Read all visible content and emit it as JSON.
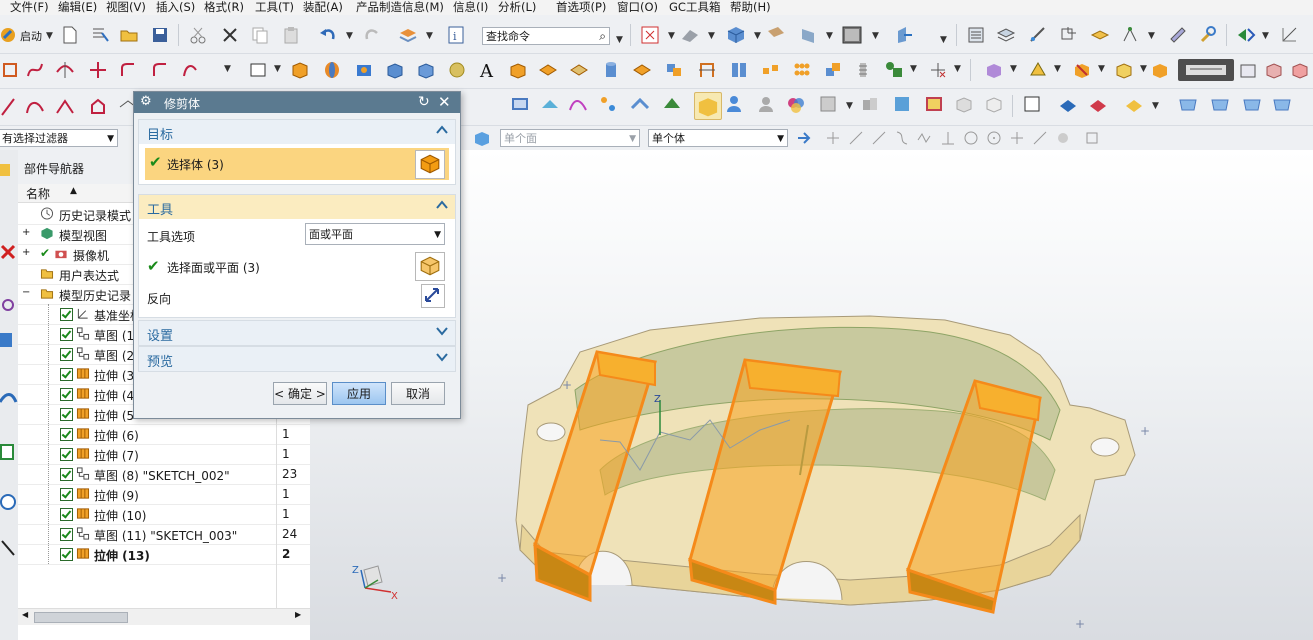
{
  "menubar": [
    "文件(F)",
    "编辑(E)",
    "视图(V)",
    "插入(S)",
    "格式(R)",
    "工具(T)",
    "装配(A)",
    "产品制造信息(M)",
    "信息(I)",
    "分析(L)",
    "首选项(P)",
    "窗口(O)",
    "GC工具箱",
    "帮助(H)"
  ],
  "toolbar": {
    "start_label": "启动",
    "command_search_placeholder": "查找命令"
  },
  "selection_bar": {
    "filter_value": "有选择过滤器",
    "face_rule": "单个面",
    "body_rule": "单个体"
  },
  "navigator": {
    "title": "部件导航器",
    "col_name": "名称",
    "col_sort_glyph": "▲",
    "top_nodes": [
      "历史记录模式",
      "模型视图",
      "摄像机",
      "用户表达式",
      "模型历史记录"
    ],
    "features": [
      {
        "label": "基准坐标",
        "num": "",
        "type": "datum"
      },
      {
        "label": "草图 (1",
        "num": "",
        "type": "sketch"
      },
      {
        "label": "草图 (2",
        "num": "",
        "type": "sketch"
      },
      {
        "label": "拉伸 (3",
        "num": "",
        "type": "extrude"
      },
      {
        "label": "拉伸 (4",
        "num": "",
        "type": "extrude"
      },
      {
        "label": "拉伸 (5",
        "num": "1",
        "type": "extrude"
      },
      {
        "label": "拉伸 (6)",
        "num": "1",
        "type": "extrude"
      },
      {
        "label": "拉伸 (7)",
        "num": "1",
        "type": "extrude"
      },
      {
        "label": "草图 (8) \"SKETCH_002\"",
        "num": "23",
        "type": "sketch"
      },
      {
        "label": "拉伸 (9)",
        "num": "1",
        "type": "extrude"
      },
      {
        "label": "拉伸 (10)",
        "num": "1",
        "type": "extrude"
      },
      {
        "label": "草图 (11) \"SKETCH_003\"",
        "num": "24",
        "type": "sketch"
      },
      {
        "label": "拉伸 (13)",
        "num": "2",
        "type": "extrude",
        "bold": true
      }
    ]
  },
  "dialog": {
    "title": "修剪体",
    "target_section": "目标",
    "select_body": "选择体 (3)",
    "tool_section": "工具",
    "tool_option_label": "工具选项",
    "tool_option_value": "面或平面",
    "select_face": "选择面或平面 (3)",
    "reverse_label": "反向",
    "settings_section": "设置",
    "preview_section": "预览",
    "ok": "< 确定 >",
    "apply": "应用",
    "cancel": "取消"
  },
  "viewport": {
    "triad_z": "Z",
    "triad_x": "X",
    "csys_z": "Z"
  },
  "colors": {
    "title_bar": "#5b7a90",
    "section_header": "#2a6aa0",
    "selected_row": "#fbd580",
    "tool_body_orange": "#f7a21e",
    "part_body": "#efe2b8"
  }
}
